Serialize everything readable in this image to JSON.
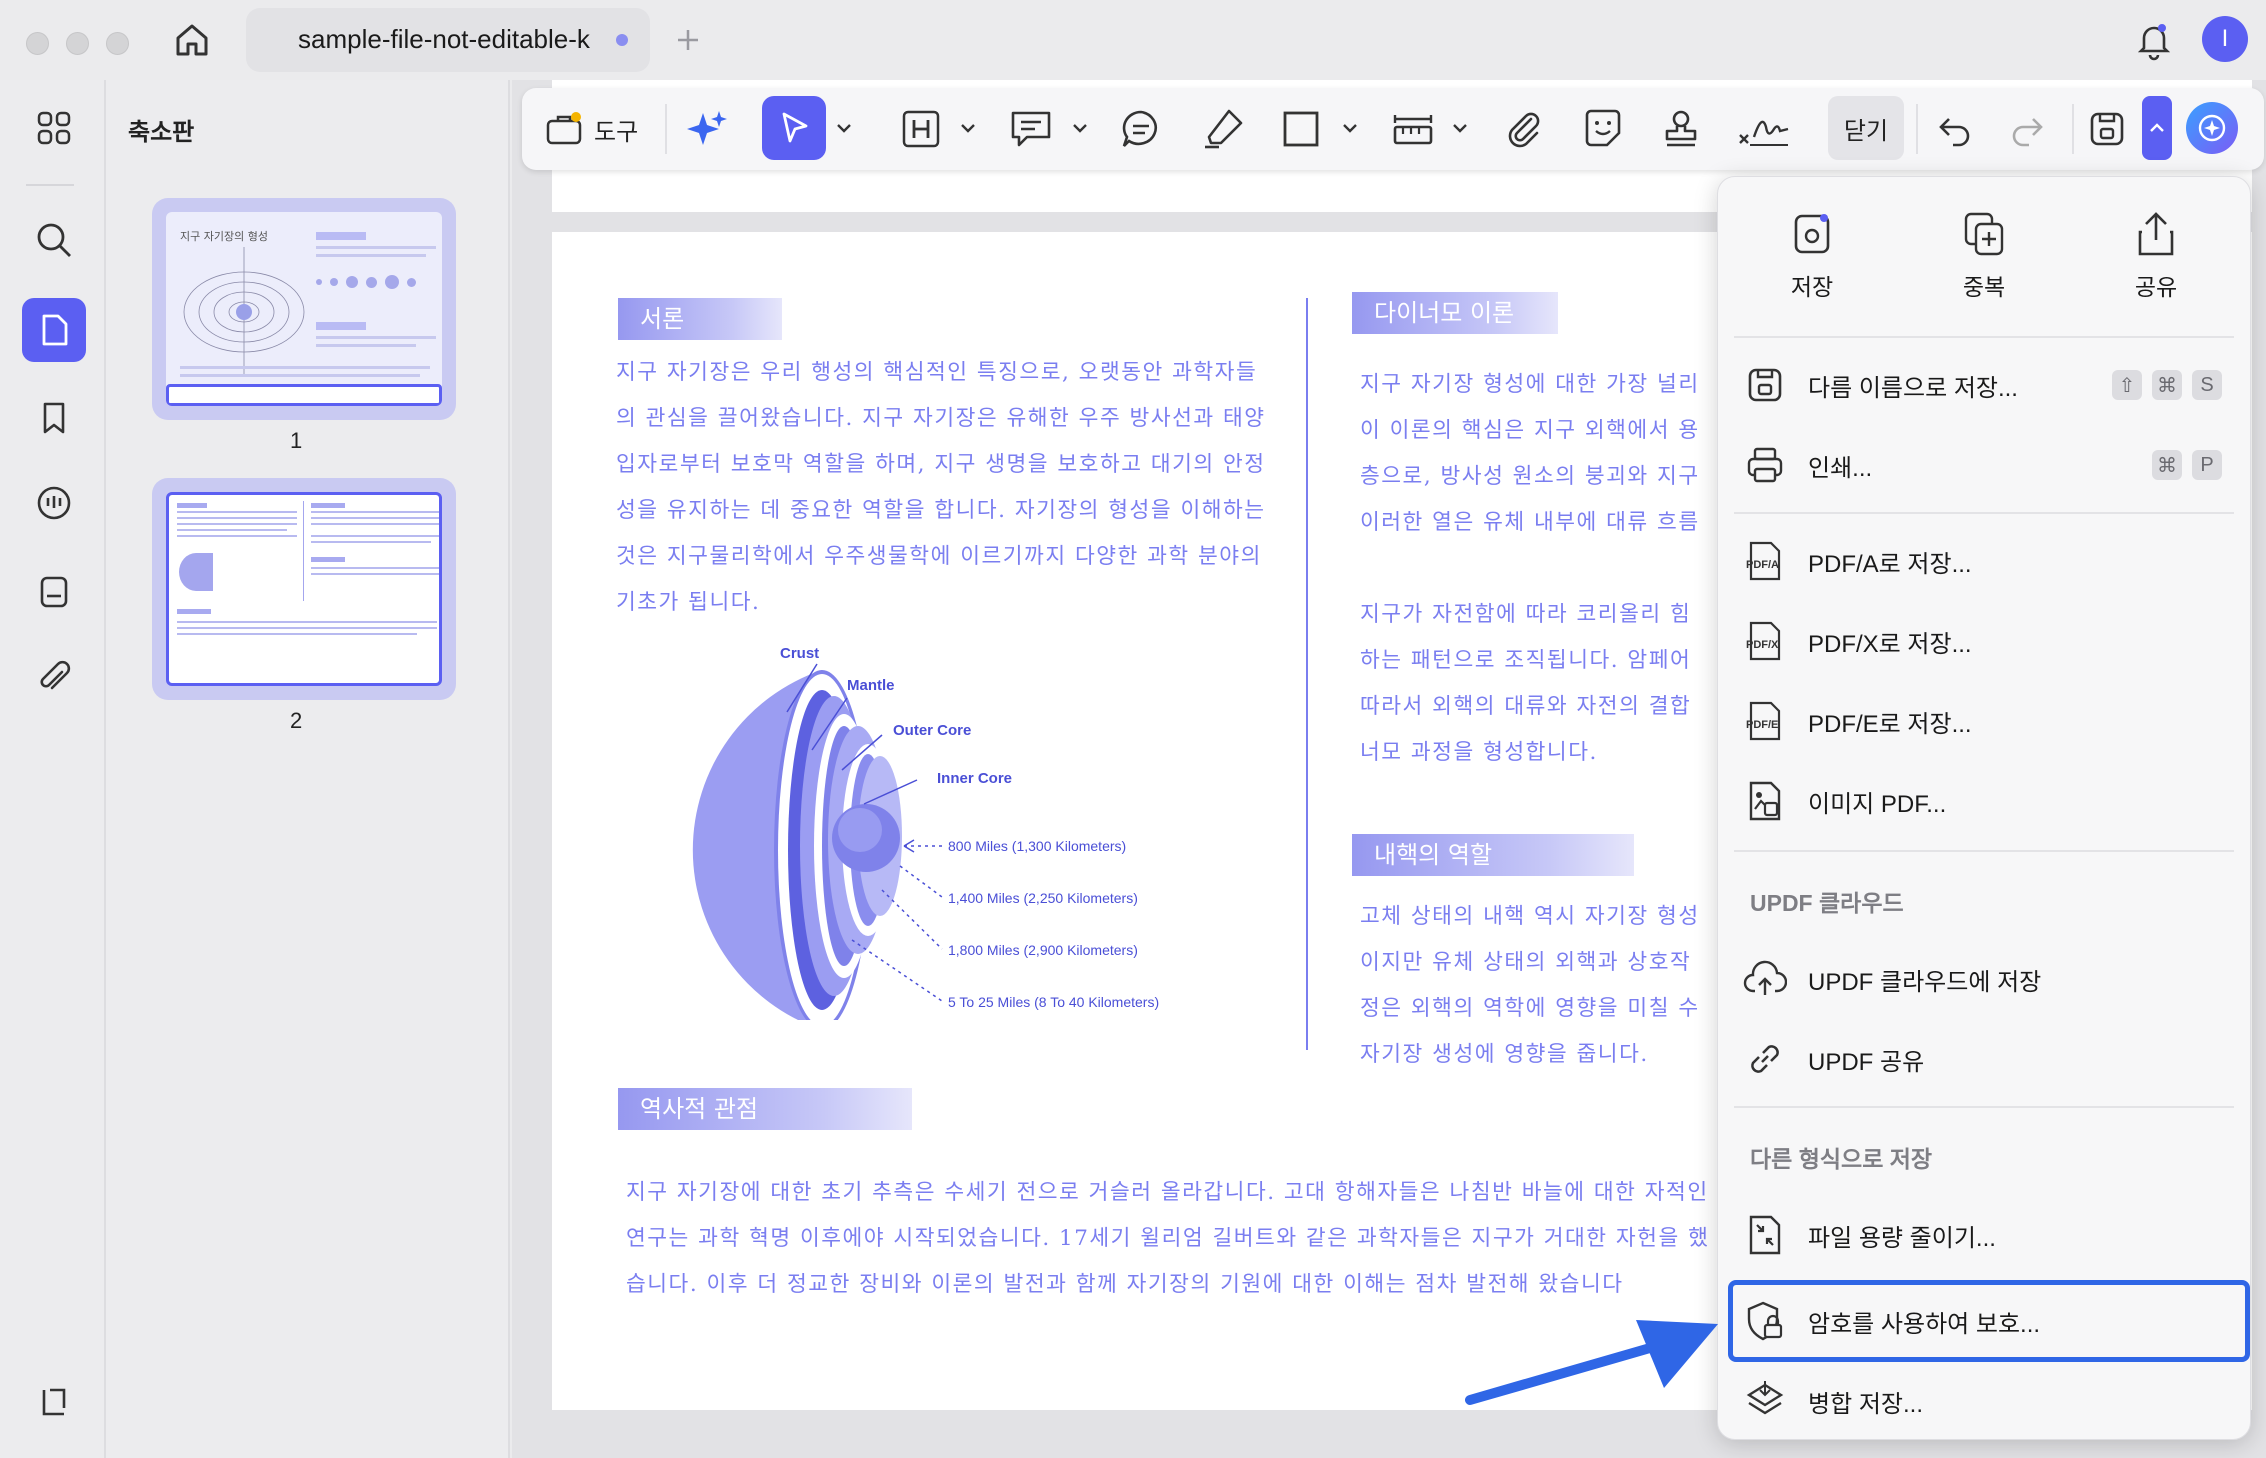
{
  "tab": {
    "title": "sample-file-not-editable-k"
  },
  "avatar": {
    "letter": "I"
  },
  "thumbnails": {
    "title": "축소판",
    "pages": [
      "1",
      "2"
    ],
    "page1_title": "지구 자기장의 형성"
  },
  "toolbar": {
    "tools_label": "도구",
    "close_label": "닫기"
  },
  "document": {
    "intro": {
      "heading": "서론",
      "text": "지구 자기장은 우리 행성의 핵심적인 특징으로, 오랫동안 과학자들의 관심을 끌어왔습니다. 지구 자기장은 유해한 우주 방사선과 태양 입자로부터 보호막 역할을 하며, 지구 생명을 보호하고 대기의 안정성을 유지하는 데 중요한 역할을 합니다. 자기장의 형성을 이해하는 것은 지구물리학에서 우주생물학에 이르기까지 다양한 과학 분야의 기초가 됩니다."
    },
    "diagram": {
      "labels": [
        "Crust",
        "Mantle",
        "Outer Core",
        "Inner Core"
      ],
      "depths": [
        "800 Miles (1,300 Kilometers)",
        "1,400 Miles (2,250 Kilometers)",
        "1,800 Miles (2,900 Kilometers)",
        "5 To 25 Miles (8 To 40 Kilometers)"
      ]
    },
    "dynamo": {
      "heading": "다이너모 이론",
      "p1": "지구 자기장 형성에 대한 가장 널리 이 이론의 핵심은 지구 외핵에서 용층으로, 방사성 원소의 붕괴와 지구 이러한 열은 유체 내부에 대류 흐름",
      "p2": "지구가 자전함에 따라 코리올리 힘 하는 패턴으로 조직됩니다. 암페어 따라서 외핵의 대류와 자전의 결합 너모 과정을 형성합니다."
    },
    "inner_core": {
      "heading": "내핵의 역할",
      "text": "고체 상태의 내핵 역시 자기장 형성 이지만 유체 상태의 외핵과 상호작 정은 외핵의 역학에 영향을 미칠 수 자기장 생성에 영향을 줍니다."
    },
    "history": {
      "heading": "역사적 관점",
      "text": "지구 자기장에 대한 초기 추측은 수세기 전으로 거슬러 올라갑니다. 고대 항해자들은 나침반 바늘에 대한 자적인 연구는 과학 혁명 이후에야 시작되었습니다. 17세기 윌리엄 길버트와 같은 과학자들은 지구가 거대한 자헌을 했습니다. 이후 더 정교한 장비와 이론의 발전과 함께 자기장의 기원에 대한 이해는 점차 발전해 왔습니다"
    }
  },
  "menu": {
    "top": [
      {
        "label": "저장"
      },
      {
        "label": "중복"
      },
      {
        "label": "공유"
      }
    ],
    "save_as": "다름 이름으로 저장...",
    "save_as_keys": [
      "⇧",
      "⌘",
      "S"
    ],
    "print": "인쇄...",
    "print_keys": [
      "⌘",
      "P"
    ],
    "pdfa": "PDF/A로 저장...",
    "pdfx": "PDF/X로 저장...",
    "pdfe": "PDF/E로 저장...",
    "image_pdf": "이미지 PDF...",
    "cloud_header": "UPDF 클라우드",
    "cloud_save": "UPDF 클라우드에 저장",
    "updf_share": "UPDF 공유",
    "other_header": "다른 형식으로 저장",
    "reduce": "파일 용량 줄이기...",
    "protect": "암호를 사용하여 보호...",
    "flatten": "병합 저장..."
  },
  "colors": {
    "accent": "#5b5ff2",
    "doc_text": "#7a7ef0",
    "highlight": "#2f66e6"
  }
}
